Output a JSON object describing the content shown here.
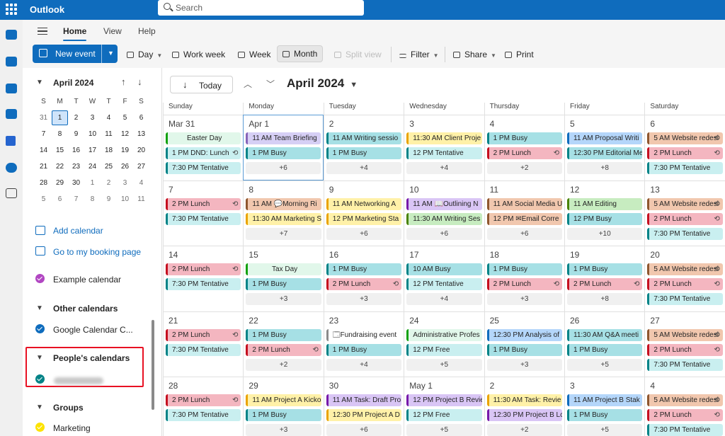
{
  "app": {
    "name": "Outlook",
    "search_placeholder": "Search"
  },
  "rail": {
    "icons": [
      "mail-icon",
      "calendar-icon",
      "people-icon",
      "groups-icon",
      "todo-icon",
      "onedrive-icon",
      "apps-icon"
    ]
  },
  "tabs": [
    "Home",
    "View",
    "Help"
  ],
  "toolbar": {
    "new_event": "New event",
    "day": "Day",
    "work_week": "Work week",
    "week": "Week",
    "month": "Month",
    "split_view": "Split view",
    "filter": "Filter",
    "share": "Share",
    "print": "Print"
  },
  "minical": {
    "title": "April 2024",
    "weekdays": [
      "S",
      "M",
      "T",
      "W",
      "T",
      "F",
      "S"
    ],
    "weeks": [
      [
        "31",
        "1",
        "2",
        "3",
        "4",
        "5",
        "6"
      ],
      [
        "7",
        "8",
        "9",
        "10",
        "11",
        "12",
        "13"
      ],
      [
        "14",
        "15",
        "16",
        "17",
        "18",
        "19",
        "20"
      ],
      [
        "21",
        "22",
        "23",
        "24",
        "25",
        "26",
        "27"
      ],
      [
        "28",
        "29",
        "30",
        "1",
        "2",
        "3",
        "4"
      ],
      [
        "5",
        "6",
        "7",
        "8",
        "9",
        "10",
        "11"
      ]
    ]
  },
  "pane": {
    "add_calendar": "Add calendar",
    "booking": "Go to my booking page",
    "example_calendar": "Example calendar",
    "other_calendars": "Other calendars",
    "google_calendar": "Google Calendar C...",
    "peoples_calendars": "People's calendars",
    "groups": "Groups",
    "marketing": "Marketing"
  },
  "calendar": {
    "today": "Today",
    "title": "April 2024",
    "days": [
      "Sunday",
      "Monday",
      "Tuesday",
      "Wednesday",
      "Thursday",
      "Friday",
      "Saturday"
    ],
    "colors": {
      "lavender": [
        "#d6cff5",
        "#8764b8"
      ],
      "teal": [
        "#a6e0e5",
        "#038387"
      ],
      "red": [
        "#f4b6c0",
        "#c50f1f"
      ],
      "yellow": [
        "#fff1a8",
        "#eaa300"
      ],
      "blue": [
        "#b4d6fa",
        "#0f6cbd"
      ],
      "brown": [
        "#f1c7ae",
        "#8e562e"
      ],
      "green": [
        "#c7ecc0",
        "#498205"
      ],
      "purple": [
        "#d9c5f5",
        "#7719aa"
      ],
      "teallight": [
        "#c9eff0",
        "#038387"
      ],
      "white": [
        "#ffffff",
        "#8a8a8a"
      ],
      "mint": [
        "#e1f7ea",
        "#13a10e"
      ]
    },
    "weeks": [
      {
        "cells": [
          {
            "d": "Mar 31",
            "ev": [
              [
                "",
                "teallight",
                1,
                0,
                0
              ],
              [
                "Easter Day",
                "mint",
                0,
                0,
                1
              ],
              [
                "1 PM DND: Lunch",
                "teallight",
                0,
                1,
                0
              ],
              [
                "7:30 PM Tentative",
                "teallight",
                1,
                0,
                0
              ]
            ],
            "more": ""
          },
          {
            "d": "Apr 1",
            "sel": true,
            "ev": [
              [
                "11 AM Team Briefing",
                "lavender",
                0,
                0,
                0
              ],
              [
                "1 PM Busy",
                "teal",
                0,
                0,
                0
              ]
            ],
            "more": "+6"
          },
          {
            "d": "2",
            "ev": [
              [
                "11 AM Writing sessio",
                "teal",
                0,
                0,
                0
              ],
              [
                "1 PM Busy",
                "teal",
                0,
                0,
                0
              ]
            ],
            "more": "+4"
          },
          {
            "d": "3",
            "ev": [
              [
                "11:30 AM Client Proje",
                "yellow",
                0,
                0,
                0
              ],
              [
                "12 PM Tentative",
                "teallight",
                1,
                0,
                0
              ]
            ],
            "more": "+4"
          },
          {
            "d": "4",
            "ev": [
              [
                "1 PM Busy",
                "teal",
                0,
                0,
                0
              ],
              [
                "2 PM Lunch",
                "red",
                0,
                1,
                0
              ]
            ],
            "more": "+2"
          },
          {
            "d": "5",
            "ev": [
              [
                "11 AM Proposal Writi",
                "blue",
                0,
                0,
                0
              ],
              [
                "12:30 PM Editorial Me",
                "teal",
                0,
                0,
                0
              ]
            ],
            "more": "+8"
          },
          {
            "d": "6",
            "ev": [
              [
                "5 AM Website redesi",
                "brown",
                0,
                1,
                0
              ],
              [
                "2 PM Lunch",
                "red",
                0,
                1,
                0
              ],
              [
                "7:30 PM Tentative",
                "teallight",
                1,
                0,
                0
              ]
            ],
            "more": ""
          }
        ]
      },
      {
        "cells": [
          {
            "d": "7",
            "ev": [
              [
                "2 PM Lunch",
                "red",
                0,
                1,
                0
              ],
              [
                "7:30 PM Tentative",
                "teallight",
                1,
                0,
                0
              ]
            ],
            "more": ""
          },
          {
            "d": "8",
            "ev": [
              [
                "11 AM 💬Morning Ri",
                "brown",
                0,
                0,
                0
              ],
              [
                "11:30 AM Marketing S",
                "yellow",
                0,
                0,
                0
              ]
            ],
            "more": "+7"
          },
          {
            "d": "9",
            "ev": [
              [
                "11 AM Networking A",
                "yellow",
                0,
                0,
                0
              ],
              [
                "12 PM Marketing Sta",
                "yellow",
                0,
                0,
                0
              ]
            ],
            "more": "+6"
          },
          {
            "d": "10",
            "ev": [
              [
                "11 AM 📖Outlining N",
                "purple",
                0,
                0,
                0
              ],
              [
                "11:30 AM Writing Ses",
                "green",
                0,
                0,
                0
              ]
            ],
            "more": "+6"
          },
          {
            "d": "11",
            "ev": [
              [
                "11 AM Social Media U",
                "brown",
                0,
                0,
                0
              ],
              [
                "12 PM ✉Email Corre",
                "brown",
                0,
                0,
                0
              ]
            ],
            "more": "+6"
          },
          {
            "d": "12",
            "ev": [
              [
                "11 AM Editing",
                "green",
                0,
                0,
                0
              ],
              [
                "12 PM Busy",
                "teal",
                0,
                0,
                0
              ]
            ],
            "more": "+10"
          },
          {
            "d": "13",
            "ev": [
              [
                "5 AM Website redesi",
                "brown",
                0,
                1,
                0
              ],
              [
                "2 PM Lunch",
                "red",
                0,
                1,
                0
              ],
              [
                "7:30 PM Tentative",
                "teallight",
                1,
                0,
                0
              ]
            ],
            "more": ""
          }
        ]
      },
      {
        "cells": [
          {
            "d": "14",
            "ev": [
              [
                "2 PM Lunch",
                "red",
                0,
                1,
                0
              ],
              [
                "7:30 PM Tentative",
                "teallight",
                1,
                0,
                0
              ]
            ],
            "more": ""
          },
          {
            "d": "15",
            "ev": [
              [
                "Tax Day",
                "mint",
                0,
                0,
                1
              ],
              [
                "1 PM Busy",
                "teal",
                0,
                0,
                0
              ]
            ],
            "more": "+3"
          },
          {
            "d": "16",
            "ev": [
              [
                "1 PM Busy",
                "teal",
                0,
                0,
                0
              ],
              [
                "2 PM Lunch",
                "red",
                0,
                1,
                0
              ]
            ],
            "more": "+3"
          },
          {
            "d": "17",
            "ev": [
              [
                "10 AM Busy",
                "teal",
                0,
                0,
                0
              ],
              [
                "12 PM Tentative",
                "teallight",
                1,
                0,
                0
              ]
            ],
            "more": "+4"
          },
          {
            "d": "18",
            "ev": [
              [
                "1 PM Busy",
                "teal",
                0,
                0,
                0
              ],
              [
                "2 PM Lunch",
                "red",
                0,
                1,
                0
              ]
            ],
            "more": "+3"
          },
          {
            "d": "19",
            "ev": [
              [
                "1 PM Busy",
                "teal",
                0,
                0,
                0
              ],
              [
                "2 PM Lunch",
                "red",
                0,
                1,
                0
              ]
            ],
            "more": "+8"
          },
          {
            "d": "20",
            "ev": [
              [
                "5 AM Website redesi",
                "brown",
                0,
                1,
                0
              ],
              [
                "2 PM Lunch",
                "red",
                0,
                1,
                0
              ],
              [
                "7:30 PM Tentative",
                "teallight",
                1,
                0,
                0
              ]
            ],
            "more": ""
          }
        ]
      },
      {
        "cells": [
          {
            "d": "21",
            "ev": [
              [
                "2 PM Lunch",
                "red",
                0,
                1,
                0
              ],
              [
                "7:30 PM Tentative",
                "teallight",
                1,
                0,
                0
              ]
            ],
            "more": ""
          },
          {
            "d": "22",
            "ev": [
              [
                "1 PM Busy",
                "teal",
                0,
                0,
                0
              ],
              [
                "2 PM Lunch",
                "red",
                0,
                1,
                0
              ]
            ],
            "more": "+2"
          },
          {
            "d": "23",
            "ev": [
              [
                "🗔Fundraising event",
                "white",
                0,
                0,
                0
              ],
              [
                "1 PM Busy",
                "teal",
                0,
                0,
                0
              ]
            ],
            "more": "+4"
          },
          {
            "d": "24",
            "ev": [
              [
                "Administrative Profes",
                "mint",
                0,
                0,
                0
              ],
              [
                "12 PM Free",
                "teallight",
                0,
                0,
                0
              ]
            ],
            "more": "+5"
          },
          {
            "d": "25",
            "ev": [
              [
                "12:30 PM Analysis of",
                "blue",
                0,
                0,
                0
              ],
              [
                "1 PM Busy",
                "teal",
                0,
                0,
                0
              ]
            ],
            "more": "+3"
          },
          {
            "d": "26",
            "ev": [
              [
                "11:30 AM Q&A meeti",
                "teal",
                0,
                0,
                0
              ],
              [
                "1 PM Busy",
                "teal",
                0,
                0,
                0
              ]
            ],
            "more": "+5"
          },
          {
            "d": "27",
            "ev": [
              [
                "5 AM Website redesi",
                "brown",
                0,
                1,
                0
              ],
              [
                "2 PM Lunch",
                "red",
                0,
                1,
                0
              ],
              [
                "7:30 PM Tentative",
                "teallight",
                1,
                0,
                0
              ]
            ],
            "more": ""
          }
        ]
      },
      {
        "cells": [
          {
            "d": "28",
            "ev": [
              [
                "2 PM Lunch",
                "red",
                0,
                1,
                0
              ],
              [
                "7:30 PM Tentative",
                "teallight",
                1,
                0,
                0
              ]
            ],
            "more": ""
          },
          {
            "d": "29",
            "ev": [
              [
                "11 AM Project A Kicko",
                "yellow",
                0,
                0,
                0
              ],
              [
                "1 PM Busy",
                "teal",
                0,
                0,
                0
              ]
            ],
            "more": "+3"
          },
          {
            "d": "30",
            "ev": [
              [
                "11 AM Task: Draft Pro",
                "purple",
                0,
                0,
                0
              ],
              [
                "12:30 PM Project A D",
                "yellow",
                0,
                0,
                0
              ]
            ],
            "more": "+6"
          },
          {
            "d": "May 1",
            "ev": [
              [
                "12 PM Project B Revie",
                "purple",
                0,
                0,
                0
              ],
              [
                "12 PM Free",
                "teallight",
                0,
                0,
                0
              ]
            ],
            "more": "+5"
          },
          {
            "d": "2",
            "ev": [
              [
                "11:30 AM Task: Revie",
                "yellow",
                0,
                0,
                0
              ],
              [
                "12:30 PM Project B Lc",
                "purple",
                0,
                0,
                0
              ]
            ],
            "more": "+2"
          },
          {
            "d": "3",
            "ev": [
              [
                "11 AM Project B Stak",
                "blue",
                0,
                0,
                0
              ],
              [
                "1 PM Busy",
                "teal",
                0,
                0,
                0
              ]
            ],
            "more": "+5"
          },
          {
            "d": "4",
            "ev": [
              [
                "5 AM Website redesi",
                "brown",
                0,
                1,
                0
              ],
              [
                "2 PM Lunch",
                "red",
                0,
                1,
                0
              ],
              [
                "7:30 PM Tentative",
                "teallight",
                1,
                0,
                0
              ]
            ],
            "more": ""
          }
        ]
      }
    ]
  }
}
